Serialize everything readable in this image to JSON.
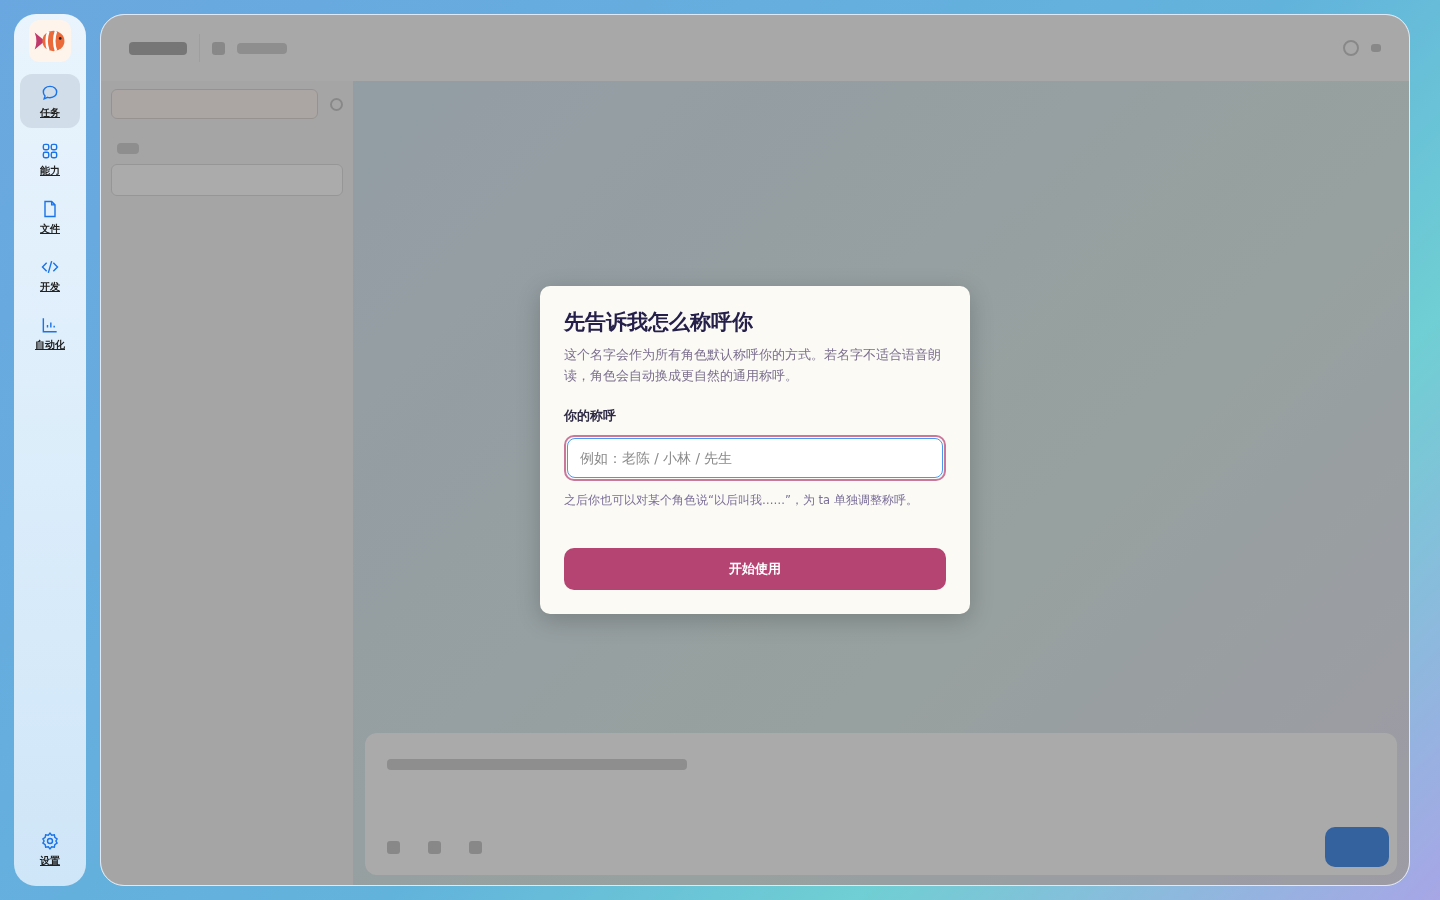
{
  "sidebar": {
    "items": [
      {
        "label": "任务",
        "selected": true
      },
      {
        "label": "能力",
        "selected": false
      },
      {
        "label": "文件",
        "selected": false
      },
      {
        "label": "开发",
        "selected": false
      },
      {
        "label": "自动化",
        "selected": false
      }
    ],
    "settings": {
      "label": "设置"
    }
  },
  "dialog": {
    "title": "先告诉我怎么称呼你",
    "description": "这个名字会作为所有角色默认称呼你的方式。若名字不适合语音朗读，角色会自动换成更自然的通用称呼。",
    "field_label": "你的称呼",
    "field": {
      "placeholder": "例如：老陈 / 小林 / 先生"
    },
    "hint": "之后你也可以对某个角色说“以后叫我……”，为 ta 单独调整称呼。",
    "button": "开始使用"
  }
}
